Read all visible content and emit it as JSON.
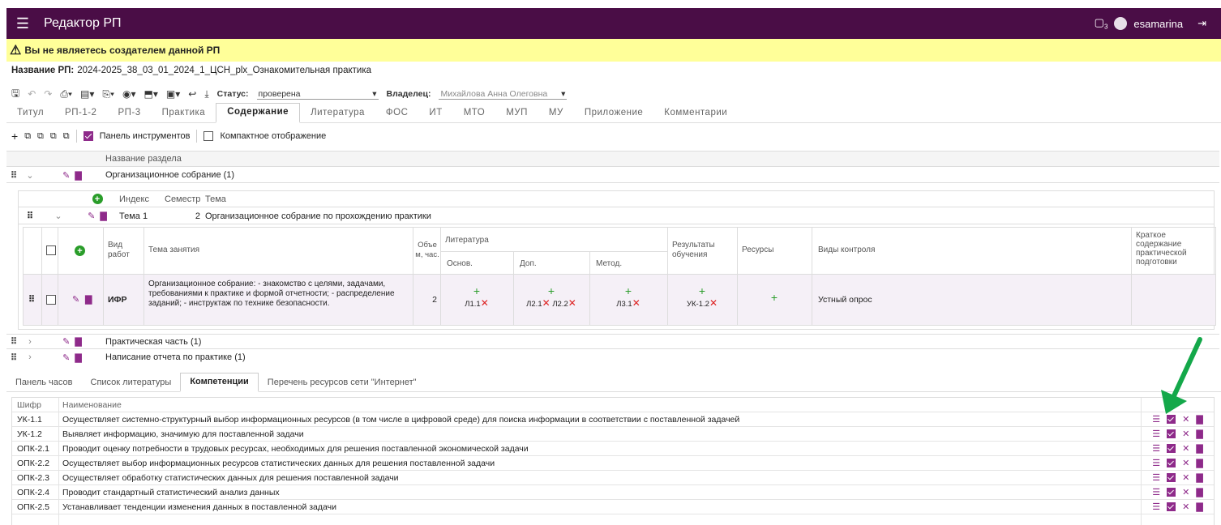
{
  "app": {
    "title": "Редактор РП",
    "user": "esamarina",
    "docs_badge": "3"
  },
  "warning": "Вы не являетесь создателем данной РП",
  "rp": {
    "label": "Название РП:",
    "value": "2024-2025_38_03_01_2024_1_ЦСН_plx_Ознакомительная практика"
  },
  "toolbar": {
    "status_label": "Статус:",
    "status_value": "проверена",
    "owner_label": "Владелец:",
    "owner_value": "Михайлова Анна Олеговна"
  },
  "tabs": [
    "Титул",
    "РП-1-2",
    "РП-3",
    "Практика",
    "Содержание",
    "Литература",
    "ФОС",
    "ИТ",
    "МТО",
    "МУП",
    "МУ",
    "Приложение",
    "Комментарии"
  ],
  "active_tab": "Содержание",
  "subbar": {
    "panel_label": "Панель инструментов",
    "compact_label": "Компактное отображение"
  },
  "sections": {
    "header": "Название раздела",
    "items": [
      "Организационное собрание (1)",
      "Практическая часть (1)",
      "Написание отчета по практике (1)"
    ]
  },
  "topics": {
    "headers": {
      "index": "Индекс",
      "semester": "Семестр",
      "topic": "Тема"
    },
    "row": {
      "index": "Тема 1",
      "semester": "2",
      "topic": "Организационное собрание по прохождению практики"
    }
  },
  "lessons": {
    "headers": {
      "type": "Вид работ",
      "name": "Тема занятия",
      "volume": "Объе м, час.",
      "lit": "Литература",
      "lit_main": "Основ.",
      "lit_add": "Доп.",
      "lit_method": "Метод.",
      "results": "Результаты обучения",
      "resources": "Ресурсы",
      "control": "Виды контроля",
      "summary": "Краткое содержание практической подготовки"
    },
    "row": {
      "type": "ИФР",
      "name": "Организационное собрание: - знакомство с целями, задачами, требованиями к практике и формой отчетности; - распределение заданий; - инструктаж по технике безопасности.",
      "volume": "2",
      "lit_main": "Л1.1",
      "lit_add1": "Л2.1",
      "lit_add2": "Л2.2",
      "lit_method": "Л3.1",
      "result": "УК-1.2",
      "control": "Устный опрос"
    }
  },
  "bottom_tabs": [
    "Панель часов",
    "Список литературы",
    "Компетенции",
    "Перечень ресурсов сети \"Интернет\""
  ],
  "bottom_active": "Компетенции",
  "competences": {
    "headers": {
      "code": "Шифр",
      "name": "Наименование"
    },
    "rows": [
      {
        "code": "УК-1.1",
        "name": "Осуществляет системно-структурный выбор информационных ресурсов (в том числе в цифровой среде) для поиска информации в соответствии с поставленной задачей"
      },
      {
        "code": "УК-1.2",
        "name": "Выявляет информацию, значимую для поставленной задачи"
      },
      {
        "code": "ОПК-2.1",
        "name": "Проводит оценку потребности в трудовых ресурсах, необходимых для решения поставленной экономической задачи"
      },
      {
        "code": "ОПК-2.2",
        "name": "Осуществляет выбор информационных ресурсов статистических данных для решения поставленной задачи"
      },
      {
        "code": "ОПК-2.3",
        "name": "Осуществляет обработку статистических данных для решения поставленной задачи"
      },
      {
        "code": "ОПК-2.4",
        "name": "Проводит стандартный статистический анализ данных"
      },
      {
        "code": "ОПК-2.5",
        "name": "Устанавливает тенденции изменения данных в поставленной задачи"
      }
    ]
  },
  "colors": {
    "appbar": "#4a0d46",
    "accent": "#8e2a8a",
    "warning_bg": "#ffff99",
    "add_green": "#2a9d2a",
    "arrow_green": "#14a84a"
  }
}
